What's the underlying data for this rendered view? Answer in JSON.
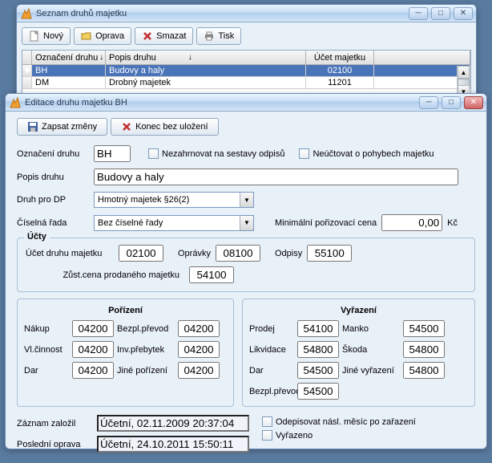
{
  "win1": {
    "title": "Seznam druhů majetku",
    "toolbar": {
      "new": "Nový",
      "edit": "Oprava",
      "delete": "Smazat",
      "print": "Tisk"
    },
    "grid": {
      "headers": {
        "col1": "Označení druhu",
        "col2": "Popis druhu",
        "col3": "Účet majetku"
      },
      "rows": [
        {
          "marker": "▶",
          "code": "BH",
          "desc": "Budovy a haly",
          "acct": "02100",
          "selected": true
        },
        {
          "marker": "",
          "code": "DM",
          "desc": "Drobný majetek",
          "acct": "11201",
          "selected": false
        }
      ]
    }
  },
  "win2": {
    "title": "Editace druhu majetku BH",
    "buttons": {
      "save": "Zapsat změny",
      "cancel": "Konec bez uložení"
    },
    "labels": {
      "oznaceni": "Označení druhu",
      "nezahrnovat": "Nezahrnovat na sestavy odpisů",
      "neuctovat": "Neúčtovat o pohybech majetku",
      "popis": "Popis druhu",
      "druhdp": "Druh pro DP",
      "ciselna": "Číselná řada",
      "minporiz": "Minimální pořizovací cena",
      "kc": "Kč",
      "ucty": "Účty",
      "ucetdruhu": "Účet druhu majetku",
      "opravky": "Oprávky",
      "odpisy": "Odpisy",
      "zustcena": "Zůst.cena prodaného majetku",
      "porizeni": "Pořízení",
      "vyrazeni": "Vyřazení",
      "nakup": "Nákup",
      "bezplprevod": "Bezpl.převod",
      "vlcinnost": "Vl.činnost",
      "invprebytek": "Inv.přebytek",
      "dar": "Dar",
      "jineporiz": "Jiné pořízení",
      "prodej": "Prodej",
      "manko": "Manko",
      "likvidace": "Likvidace",
      "skoda": "Škoda",
      "jinevyr": "Jiné vyřazení",
      "zaznam": "Záznam založil",
      "posledni": "Poslední oprava",
      "odepisovat": "Odepisovat násl. měsíc po zařazení",
      "vyrazeno": "Vyřazeno"
    },
    "values": {
      "oznaceni": "BH",
      "popis": "Budovy a haly",
      "druhdp": "Hmotný majetek §26(2)",
      "ciselna": "Bez číselné řady",
      "minporiz": "0,00",
      "ucetdruhu": "02100",
      "opravky": "08100",
      "odpisy": "55100",
      "zustcena": "54100",
      "por_nakup": "04200",
      "por_bezpl": "04200",
      "por_vlcin": "04200",
      "por_invpr": "04200",
      "por_dar": "04200",
      "por_jine": "04200",
      "vyr_prodej": "54100",
      "vyr_manko": "54500",
      "vyr_likv": "54800",
      "vyr_skoda": "54800",
      "vyr_dar": "54500",
      "vyr_jine": "54800",
      "vyr_bezpl": "54500",
      "zaznam": "Účetní, 02.11.2009 20:37:04",
      "posledni": "Účetní, 24.10.2011 15:50:11"
    }
  }
}
